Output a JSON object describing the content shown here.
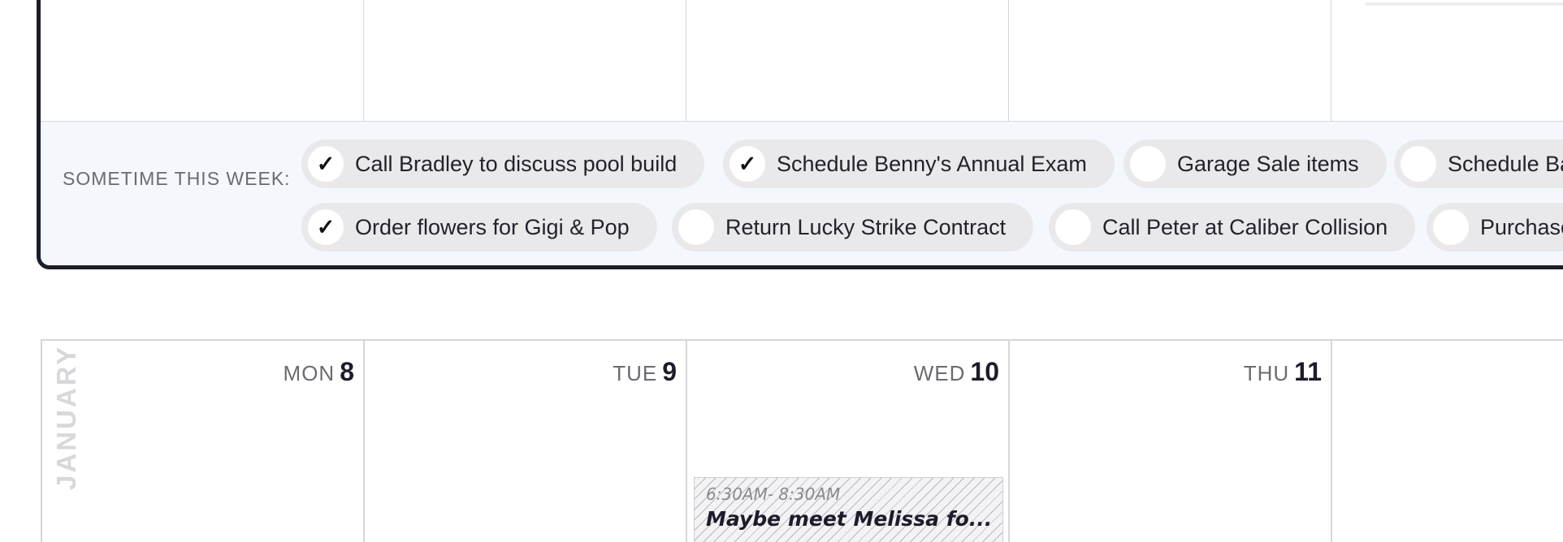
{
  "todo": {
    "label": "SOMETIME THIS WEEK:",
    "items": [
      {
        "text": "Call Bradley to discuss pool build",
        "checked": true
      },
      {
        "text": "Schedule Benny's Annual Exam",
        "checked": true
      },
      {
        "text": "Garage Sale items",
        "checked": false
      },
      {
        "text": "Schedule Ba",
        "checked": false
      },
      {
        "text": "Order flowers for Gigi & Pop",
        "checked": true
      },
      {
        "text": "Return Lucky Strike Contract",
        "checked": false
      },
      {
        "text": "Call Peter at Caliber Collision",
        "checked": false
      },
      {
        "text": "Purchase",
        "checked": false
      }
    ],
    "check_glyph": "✓"
  },
  "week2": {
    "month": "JANUARY",
    "days": [
      {
        "dow": "MON",
        "num": "8"
      },
      {
        "dow": "TUE",
        "num": "9"
      },
      {
        "dow": "WED",
        "num": "10"
      },
      {
        "dow": "THU",
        "num": "11"
      }
    ],
    "event": {
      "time": "6:30AM- 8:30AM",
      "title": "Maybe meet Melissa fo..."
    }
  },
  "colors": {
    "border": "#1d1c2b",
    "strip_bg": "#f4f7fc",
    "pill_bg": "#e9e9eb",
    "muted_text": "#6b6b73",
    "month_text": "#d8d8dc"
  }
}
